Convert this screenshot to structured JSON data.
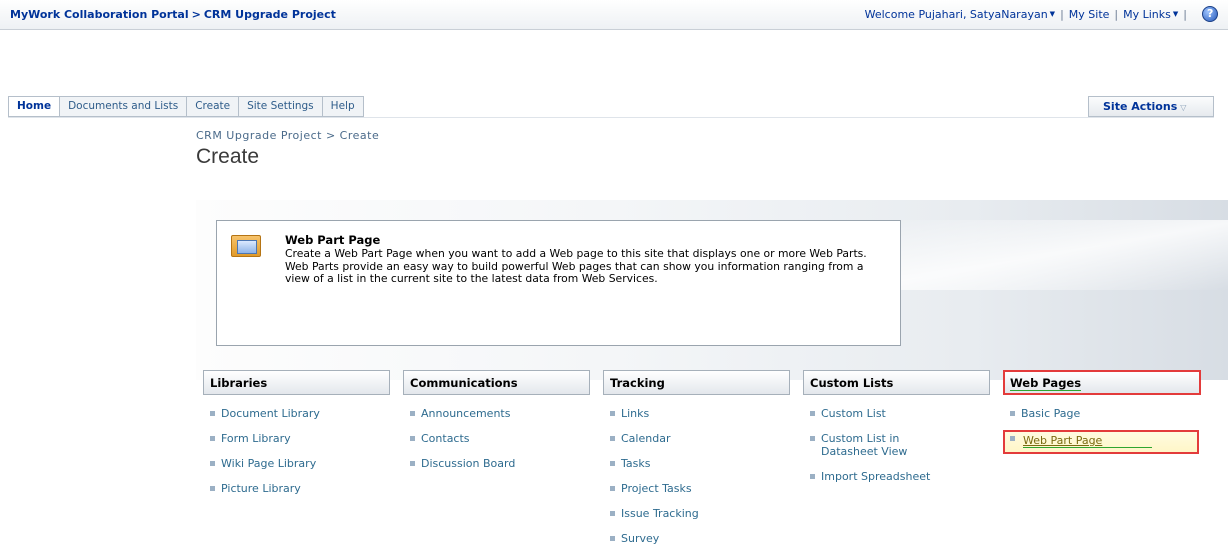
{
  "topbar": {
    "portal": "MyWork Collaboration Portal",
    "separator": ">",
    "project": "CRM Upgrade Project",
    "welcome": "Welcome Pujahari, SatyaNarayan",
    "my_site": "My Site",
    "my_links": "My Links",
    "pipe": "|"
  },
  "tabs": [
    "Home",
    "Documents and Lists",
    "Create",
    "Site Settings",
    "Help"
  ],
  "site_actions": "Site Actions",
  "breadcrumb": "CRM Upgrade Project > Create",
  "page_title": "Create",
  "description": {
    "title": "Web Part Page",
    "text": "Create a Web Part Page when you want to add a Web page to this site that displays one or more Web Parts. Web Parts provide an easy way to build powerful Web pages that can show you information ranging from a view of a list in the current site to the latest data from Web Services."
  },
  "columns": {
    "libraries": {
      "heading": "Libraries",
      "items": [
        "Document Library",
        "Form Library",
        "Wiki Page Library",
        "Picture Library"
      ]
    },
    "communications": {
      "heading": "Communications",
      "items": [
        "Announcements",
        "Contacts",
        "Discussion Board"
      ]
    },
    "tracking": {
      "heading": "Tracking",
      "items": [
        "Links",
        "Calendar",
        "Tasks",
        "Project Tasks",
        "Issue Tracking",
        "Survey"
      ]
    },
    "custom_lists": {
      "heading": "Custom Lists",
      "items": [
        "Custom List",
        "Custom List in Datasheet View",
        "Import Spreadsheet"
      ]
    },
    "web_pages": {
      "heading": "Web Pages",
      "items": [
        "Basic Page",
        "Web Part Page"
      ]
    }
  },
  "colors": {
    "link": "#2e6b8f",
    "highlight_border": "#e33b3b",
    "highlight_underline": "#2fa52f"
  }
}
